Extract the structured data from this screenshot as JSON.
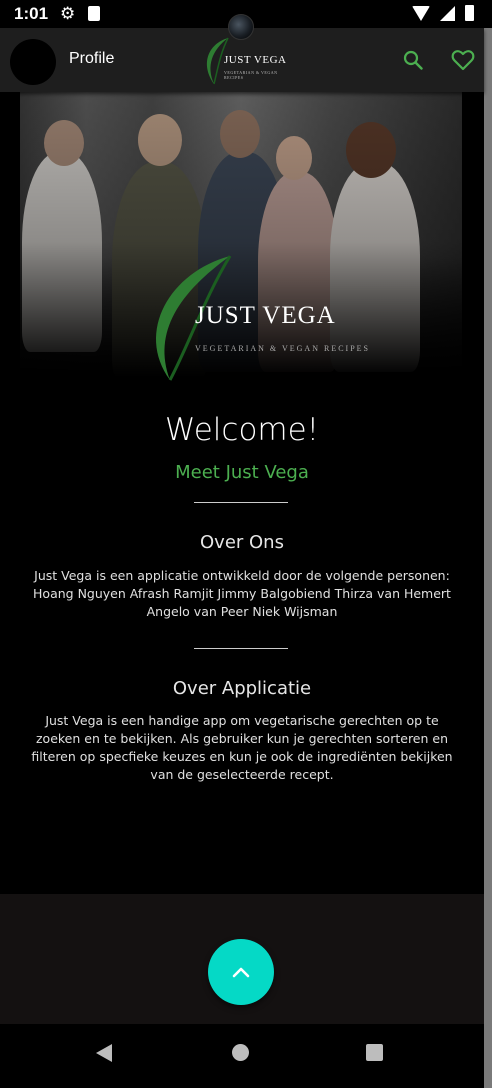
{
  "status_bar": {
    "time": "1:01"
  },
  "app_bar": {
    "profile_label": "Profile",
    "logo_brand": "JUST VEGA",
    "logo_tagline": "VEGETARIAN & VEGAN RECIPES",
    "accent_color": "#4caf50"
  },
  "hero": {
    "brand": "JUST VEGA",
    "tagline": "VEGETARIAN & VEGAN RECIPES"
  },
  "main": {
    "welcome": "Welcome!",
    "subtitle": "Meet Just Vega",
    "about_us_title": "Over Ons",
    "about_us_text": "Just Vega is een applicatie ontwikkeld door de volgende personen: Hoang Nguyen Afrash Ramjit Jimmy Balgobiend Thirza van Hemert Angelo van Peer Niek Wijsman",
    "about_app_title": "Over Applicatie",
    "about_app_text": "Just Vega is een handige app om vegetarische gerechten op te zoeken en te bekijken. Als gebruiker kun je gerechten sorteren en filteren op specfieke keuzes en kun je ook de ingrediënten bekijken van de geselecteerde recept."
  },
  "icons": {
    "settings": "gear-icon",
    "sd_card": "sd-card-icon",
    "wifi": "wifi-icon",
    "signal": "signal-icon",
    "battery": "battery-icon",
    "search": "search-icon",
    "favorites": "heart-icon",
    "scroll_top": "chevron-up-icon"
  },
  "colors": {
    "fab": "#05d9c6",
    "accent_green": "#4caf50",
    "app_bar": "#1e1e1e"
  }
}
